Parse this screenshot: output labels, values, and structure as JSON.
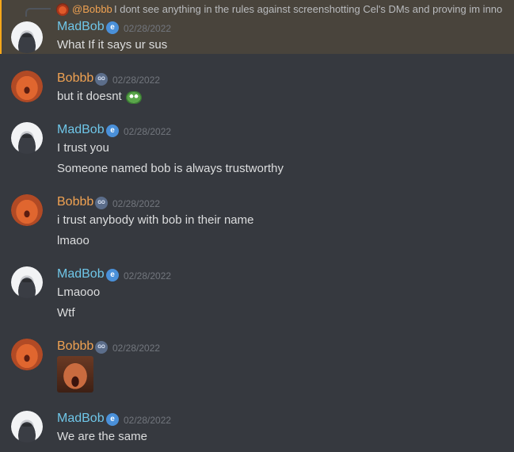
{
  "reply": {
    "author": "@Bobbb",
    "text": "I dont see anything in the rules against screenshotting Cel's DMs and proving im inno"
  },
  "messages": [
    {
      "author": "MadBob",
      "badge": "e",
      "time": "02/28/2022",
      "lines": [
        "What If it says ur sus"
      ]
    },
    {
      "author": "Bobbb",
      "badge": "GO",
      "time": "02/28/2022",
      "lines": [
        "but it doesnt"
      ],
      "emoji": "pepe-emoji"
    },
    {
      "author": "MadBob",
      "badge": "e",
      "time": "02/28/2022",
      "lines": [
        "I trust you",
        "Someone named bob is always trustworthy"
      ]
    },
    {
      "author": "Bobbb",
      "badge": "GO",
      "time": "02/28/2022",
      "lines": [
        "i trust anybody with bob in their name",
        "lmaoo"
      ]
    },
    {
      "author": "MadBob",
      "badge": "e",
      "time": "02/28/2022",
      "lines": [
        "Lmaooo",
        "Wtf"
      ]
    },
    {
      "author": "Bobbb",
      "badge": "GO",
      "time": "02/28/2022",
      "lines": [],
      "attachment": "image-attachment"
    },
    {
      "author": "MadBob",
      "badge": "e",
      "time": "02/28/2022",
      "lines": [
        "We are the same"
      ]
    }
  ],
  "colors": {
    "background": "#36393f",
    "mention_highlight": "#49443c",
    "madbob_name": "#6fc6e8",
    "bobbb_name": "#f0a252",
    "timestamp": "#72767d",
    "text": "#dcddde"
  }
}
